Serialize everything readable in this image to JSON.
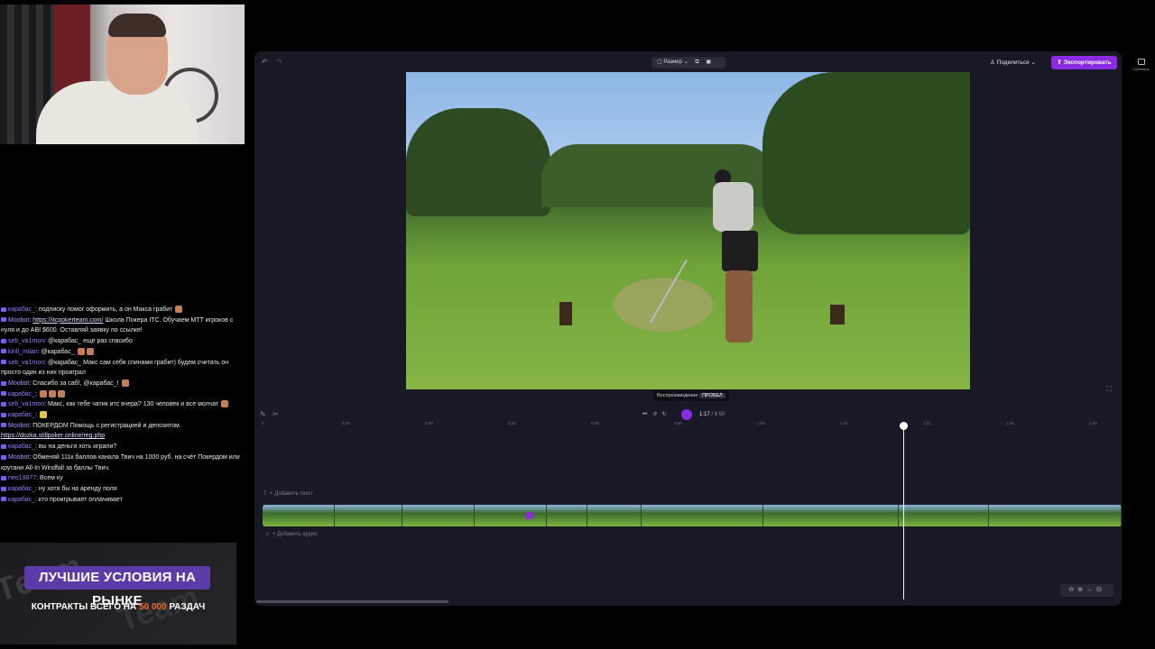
{
  "chat": [
    {
      "user": "карабас_",
      "text": "подписку помог оформить, а он Макса грабит"
    },
    {
      "user": "Moobot",
      "link": "https://itcpokerteam.com/",
      "text": "Школа Покера ITC. Обучаем МТТ игроков с нуля и до ABI $600. Оставляй заявку по ссылке!"
    },
    {
      "user": "seb_va1mon",
      "text": "@карабас_ еще раз спасибо"
    },
    {
      "user": "kirill_milan",
      "text": "@карабас_"
    },
    {
      "user": "seb_va1mon",
      "text": "@карабас_ Макс сам себя спинами грабит) будем считать он просто один из них проиграл"
    },
    {
      "user": "Moobot",
      "text": "Спасибо за саб!, @карабас_!"
    },
    {
      "user": "карабас_",
      "text": ""
    },
    {
      "user": "seb_va1mon",
      "text": "Макс, как тебе чатик итс вчера? 130 человек и все молчат"
    },
    {
      "user": "карабас_",
      "text": ""
    },
    {
      "user": "Moobot",
      "text": "ПОКЕРДОМ Помощь с регистрацией и депозитом.",
      "link2": "https://dozka.stillpoker.online/reg.php"
    },
    {
      "user": "карабас_",
      "text": "вы на деньги хоть играли?"
    },
    {
      "user": "Moobot",
      "text": "Обменяй 111к баллов канала Твич на 1000 руб. на счёт Покердом или крутани All-In Windfall за баллы Твич."
    },
    {
      "user": "neo19877",
      "text": "Всем ку"
    },
    {
      "user": "карабас_",
      "text": "ну хотя бы на аренду поля"
    },
    {
      "user": "карабас_",
      "text": "кто проигрывает оплачивает"
    }
  ],
  "banner": {
    "title": "ЛУЧШИЕ УСЛОВИЯ НА РЫНКЕ",
    "sub_prefix": "КОНТРАКТЫ ВСЕГО НА",
    "sub_highlight": "50 000",
    "sub_suffix": "РАЗДАЧ",
    "watermark": "Team"
  },
  "editor": {
    "size_label": "Размер",
    "share_label": "Поделиться",
    "export_label": "Экспортировать",
    "tooltip_label": "Воспроизведение",
    "tooltip_key": "ПРОБЕЛ",
    "current_time": "1:17",
    "duration": "/ 6:50",
    "add_text": "+ Добавить текст",
    "add_audio": "+ Добавить аудио",
    "subtitles_label": "Субтитры",
    "ruler_ticks": [
      "0",
      "0:10",
      "0:20",
      "0:30",
      "0:40",
      "0:50",
      "1:00",
      "1:10",
      "1:20",
      "1:30",
      "1:40"
    ],
    "accent": "#8a2be2"
  }
}
